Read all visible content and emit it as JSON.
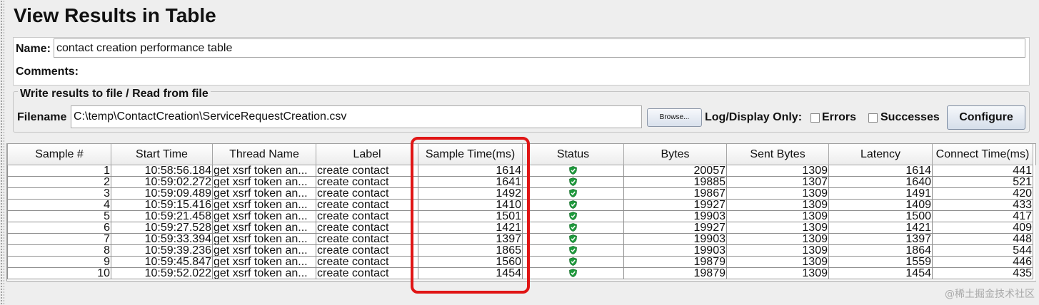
{
  "window": {
    "title": "View Results in Table"
  },
  "name_panel": {
    "name_label": "Name:",
    "name_value": "contact creation performance table",
    "comments_label": "Comments:"
  },
  "file_group": {
    "legend": "Write results to file / Read from file",
    "filename_label": "Filename",
    "filename_value": "C:\\temp\\ContactCreation\\ServiceRequestCreation.csv",
    "browse_label": "Browse...",
    "log_display_label": "Log/Display Only:",
    "errors_label": "Errors",
    "successes_label": "Successes",
    "configure_label": "Configure"
  },
  "table": {
    "headers": [
      "Sample #",
      "Start Time",
      "Thread Name",
      "Label",
      "Sample Time(ms)",
      "Status",
      "Bytes",
      "Sent Bytes",
      "Latency",
      "Connect Time(ms)"
    ],
    "rows": [
      [
        "1",
        "10:58:56.184",
        "get xsrf token an...",
        "create contact",
        "1614",
        "success",
        "20057",
        "1309",
        "1614",
        "441"
      ],
      [
        "2",
        "10:59:02.272",
        "get xsrf token an...",
        "create contact",
        "1641",
        "success",
        "19885",
        "1307",
        "1640",
        "521"
      ],
      [
        "3",
        "10:59:09.489",
        "get xsrf token an...",
        "create contact",
        "1492",
        "success",
        "19867",
        "1309",
        "1491",
        "420"
      ],
      [
        "4",
        "10:59:15.416",
        "get xsrf token an...",
        "create contact",
        "1410",
        "success",
        "19927",
        "1309",
        "1409",
        "433"
      ],
      [
        "5",
        "10:59:21.458",
        "get xsrf token an...",
        "create contact",
        "1501",
        "success",
        "19903",
        "1309",
        "1500",
        "417"
      ],
      [
        "6",
        "10:59:27.528",
        "get xsrf token an...",
        "create contact",
        "1421",
        "success",
        "19927",
        "1309",
        "1421",
        "409"
      ],
      [
        "7",
        "10:59:33.394",
        "get xsrf token an...",
        "create contact",
        "1397",
        "success",
        "19903",
        "1309",
        "1397",
        "448"
      ],
      [
        "8",
        "10:59:39.236",
        "get xsrf token an...",
        "create contact",
        "1865",
        "success",
        "19903",
        "1309",
        "1864",
        "544"
      ],
      [
        "9",
        "10:59:45.847",
        "get xsrf token an...",
        "create contact",
        "1560",
        "success",
        "19879",
        "1309",
        "1559",
        "446"
      ],
      [
        "10",
        "10:59:52.022",
        "get xsrf token an...",
        "create contact",
        "1454",
        "success",
        "19879",
        "1309",
        "1454",
        "435"
      ]
    ]
  },
  "status_icon": "green-shield-check-icon",
  "highlight_color": "#e01515",
  "watermark": "@稀土掘金技术社区"
}
